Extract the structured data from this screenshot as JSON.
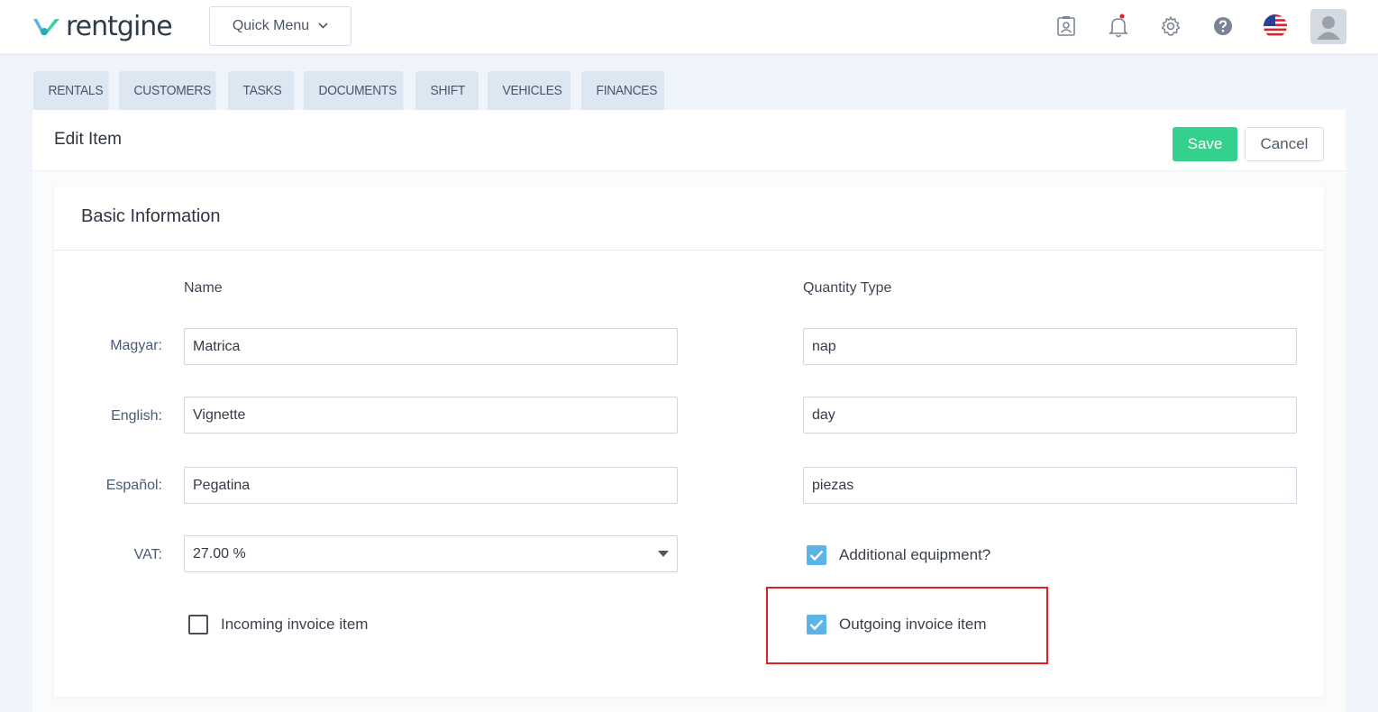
{
  "brand": {
    "name": "rentgine",
    "accent": "#5ab4e5"
  },
  "header": {
    "quick_menu_label": "Quick Menu",
    "icons": [
      "contact-card-icon",
      "bell-icon",
      "gear-icon",
      "help-icon",
      "us-flag-icon",
      "user-avatar-icon"
    ]
  },
  "tabs": [
    "RENTALS",
    "CUSTOMERS",
    "TASKS",
    "DOCUMENTS",
    "SHIFT",
    "VEHICLES",
    "FINANCES"
  ],
  "page": {
    "title": "Edit Item",
    "save_label": "Save",
    "cancel_label": "Cancel"
  },
  "form": {
    "section_title": "Basic Information",
    "name_header": "Name",
    "quantity_header": "Quantity Type",
    "rows": [
      {
        "label": "Magyar:",
        "name": "Matrica",
        "quantity": "nap"
      },
      {
        "label": "English:",
        "name": "Vignette",
        "quantity": "day"
      },
      {
        "label": "Español:",
        "name": "Pegatina",
        "quantity": "piezas"
      }
    ],
    "vat_label": "VAT:",
    "vat_value": "27.00 %",
    "additional_equipment": {
      "label": "Additional equipment?",
      "checked": true
    },
    "incoming_invoice": {
      "label": "Incoming invoice item",
      "checked": false
    },
    "outgoing_invoice": {
      "label": "Outgoing invoice item",
      "checked": true
    }
  },
  "colors": {
    "save": "#33d18b",
    "highlight": "#e02020",
    "checkbox": "#5ab4e5"
  }
}
